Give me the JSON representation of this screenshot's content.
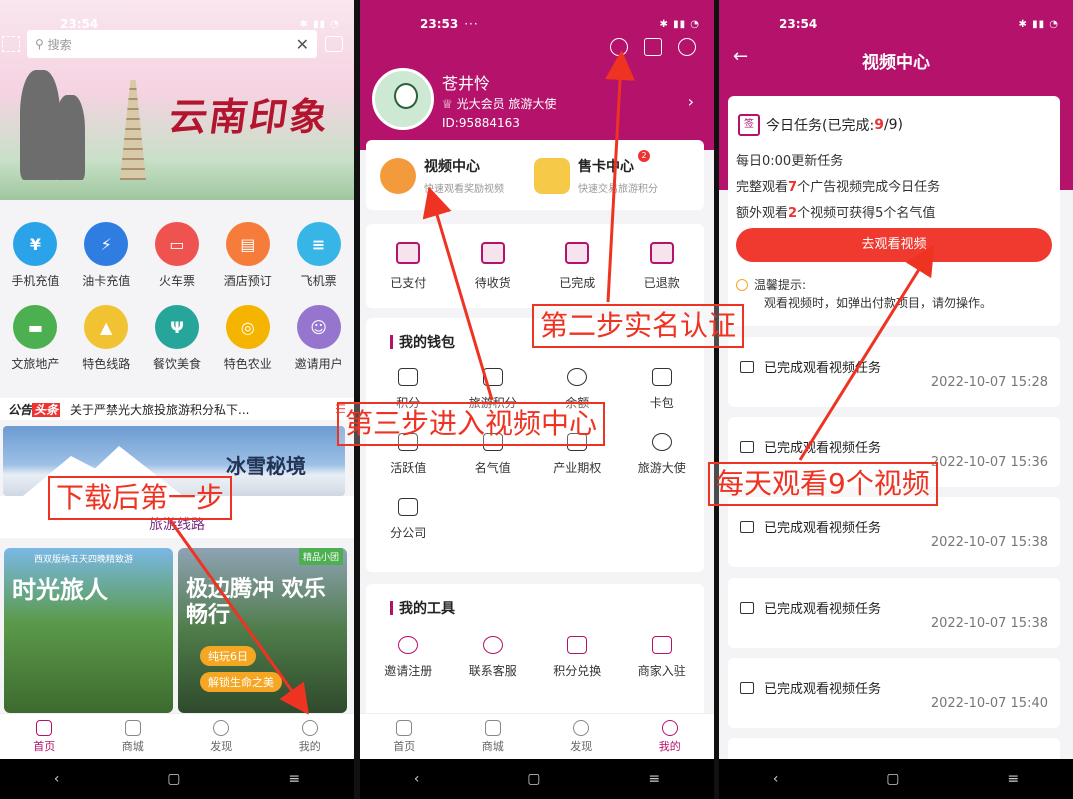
{
  "panel1": {
    "status_time": "23:54",
    "search_placeholder": "搜索",
    "banner_title": "云南印象",
    "grid": [
      {
        "label": "手机充值",
        "color": "#2aa3e8",
        "icon": "phone-icon"
      },
      {
        "label": "油卡充值",
        "color": "#2f7de1",
        "icon": "fuel-icon"
      },
      {
        "label": "火车票",
        "color": "#ef5350",
        "icon": "train-ticket-icon"
      },
      {
        "label": "酒店预订",
        "color": "#f57c3b",
        "icon": "hotel-icon"
      },
      {
        "label": "飞机票",
        "color": "#36b5e6",
        "icon": "plane-icon"
      },
      {
        "label": "文旅地产",
        "color": "#4caf50",
        "icon": "shop-icon"
      },
      {
        "label": "特色线路",
        "color": "#f1c232",
        "icon": "tent-icon"
      },
      {
        "label": "餐饮美食",
        "color": "#26a69a",
        "icon": "dining-icon"
      },
      {
        "label": "特色农业",
        "color": "#f4b400",
        "icon": "coins-icon"
      },
      {
        "label": "邀请用户",
        "color": "#9575cd",
        "icon": "user-icon"
      }
    ],
    "notice_tag_a": "公告",
    "notice_tag_b": "头条",
    "notice_text": "关于严禁光大旅投旅游积分私下...",
    "banner2_title": "冰雪秘境",
    "routes_label": "旅游线路",
    "card1_title": "时光旅人",
    "card1_small": "西双版纳五天四晚精致游",
    "card2_title": "极边腾冲 欢乐畅行",
    "card2_tag": "纯玩6日",
    "card2_tag2": "解锁生命之美",
    "card2_badge": "精品小团",
    "tabs": [
      "首页",
      "商城",
      "发现",
      "我的"
    ]
  },
  "panel2": {
    "status_time": "23:53",
    "username": "苍井怜",
    "member": "光大会员 旅游大使",
    "uid": "ID:95884163",
    "video_center": "视频中心",
    "video_sub": "快速观看奖励视频",
    "sell_card": "售卡中心",
    "sell_sub": "快速交易旅游积分",
    "badge": "2",
    "orders": [
      "已支付",
      "待收货",
      "已完成",
      "已退款"
    ],
    "wallet_title": "我的钱包",
    "wallet": [
      "积分",
      "旅游积分",
      "余额",
      "卡包",
      "活跃值",
      "名气值",
      "产业期权",
      "旅游大使",
      "分公司"
    ],
    "tools_title": "我的工具",
    "tools": [
      "邀请注册",
      "联系客服",
      "积分兑换",
      "商家入驻"
    ],
    "tabs": [
      "首页",
      "商城",
      "发现",
      "我的"
    ]
  },
  "panel3": {
    "status_time": "23:54",
    "title": "视频中心",
    "task_title_prefix": "今日任务(已完成:",
    "task_done": "9",
    "task_total": "/9)",
    "line1": "每日0:00更新任务",
    "line2_a": "完整观看",
    "line2_n": "7",
    "line2_b": "个广告视频完成今日任务",
    "line3_a": "额外观看",
    "line3_n": "2",
    "line3_b": "个视频可获得5个名气值",
    "button": "去观看视频",
    "tip_title": "温馨提示:",
    "tip_text": "观看视频时，如弹出付款项目，请勿操作。",
    "records": [
      {
        "text": "已完成观看视频任务",
        "date": "2022-10-07 15:28"
      },
      {
        "text": "已完成观看视频任务",
        "date": "2022-10-07 15:36"
      },
      {
        "text": "已完成观看视频任务",
        "date": "2022-10-07 15:38"
      },
      {
        "text": "已完成观看视频任务",
        "date": "2022-10-07 15:38"
      },
      {
        "text": "已完成观看视频任务",
        "date": "2022-10-07 15:40"
      }
    ]
  },
  "annotations": {
    "step1": "下载后第一步",
    "step2": "第二步实名认证",
    "step3": "第三步进入视频中心",
    "step4": "每天观看9个视频"
  },
  "colors": {
    "brand": "#b5126b",
    "button": "#f0392f",
    "annotation": "#e32"
  }
}
